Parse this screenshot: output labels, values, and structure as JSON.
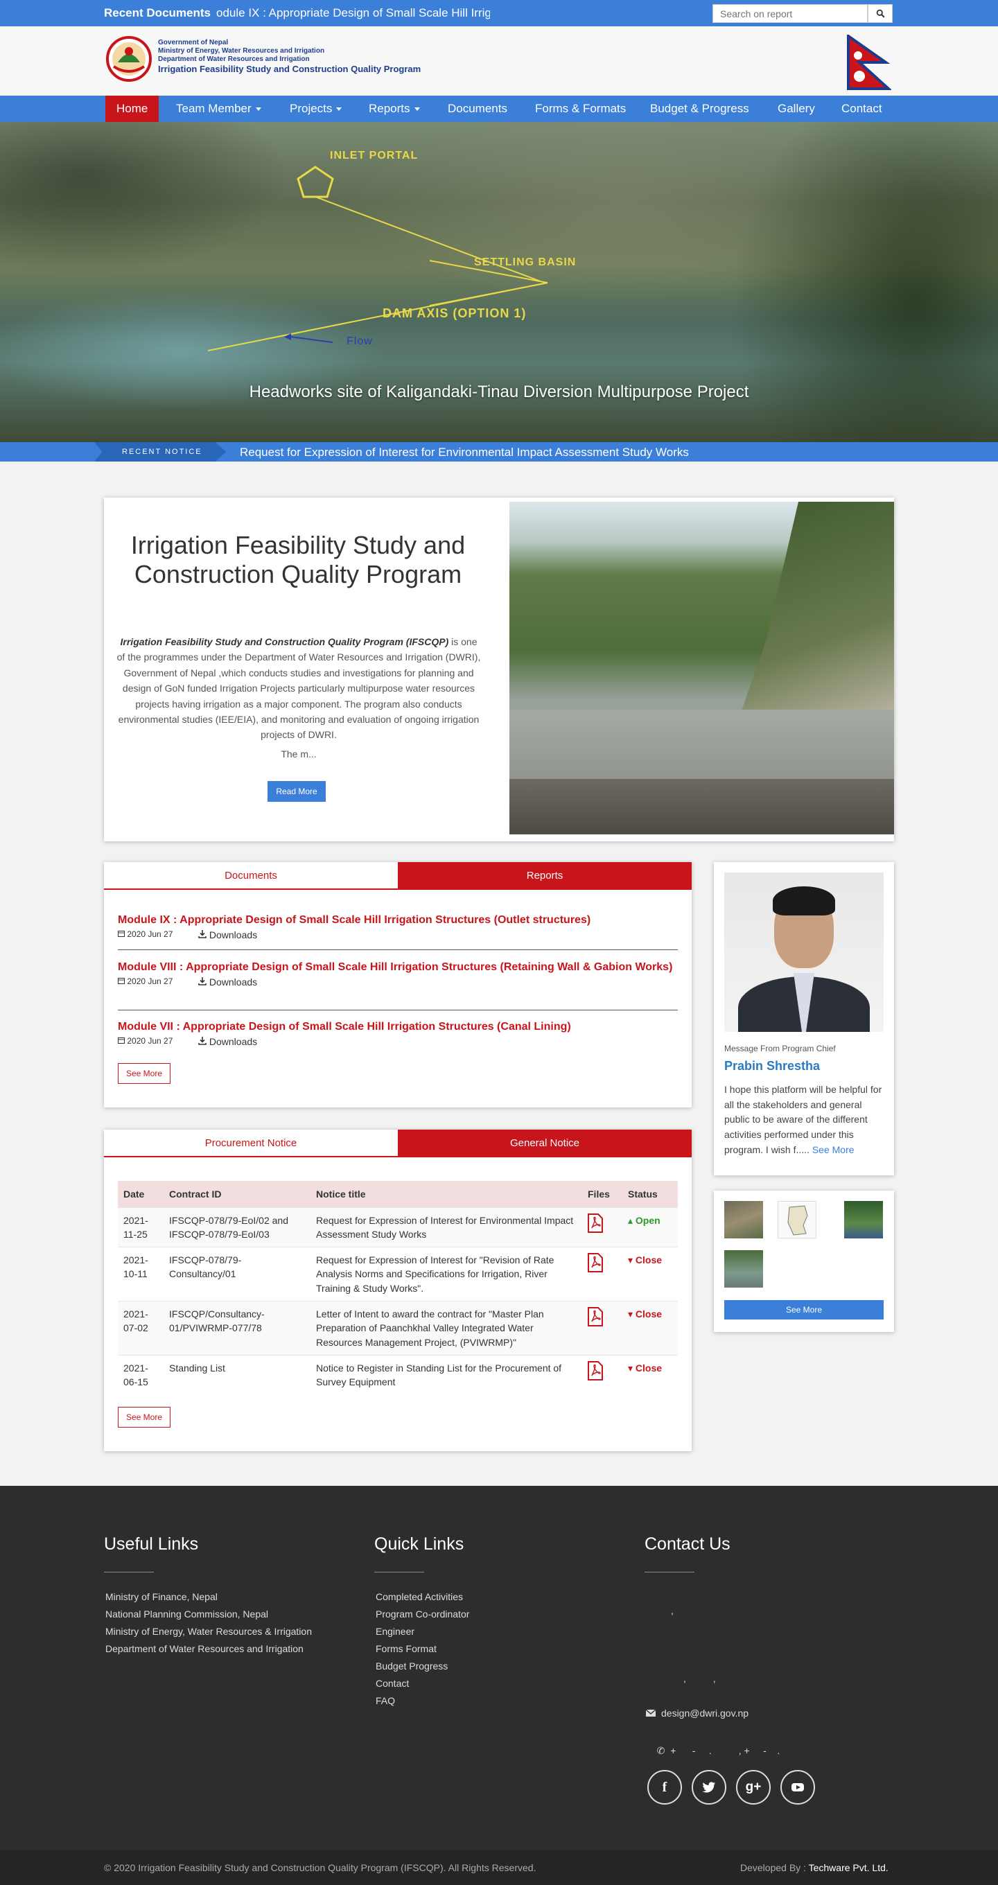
{
  "topbar": {
    "recent_documents_label": "Recent Documents",
    "recent_documents_marquee": "odule IX : Appropriate Design of Small Scale Hill Irrigatio",
    "search_placeholder": "Search on report"
  },
  "header": {
    "logo_line1": "Government of Nepal",
    "logo_line2": "Ministry of Energy, Water Resources and Irrigation",
    "logo_line3": "Department of Water Resources and Irrigation",
    "logo_line4": "Irrigation Feasibility Study and Construction Quality Program"
  },
  "nav": {
    "home": "Home",
    "team_member": "Team Member",
    "projects": "Projects",
    "reports": "Reports",
    "documents": "Documents",
    "forms_formats": "Forms & Formats",
    "budget_progress": "Budget & Progress",
    "gallery": "Gallery",
    "contact": "Contact"
  },
  "hero": {
    "caption": "Headworks site of Kaligandaki-Tinau Diversion Multipurpose Project",
    "label_inlet": "INLET PORTAL",
    "label_settling": "SETTLING BASIN",
    "label_dam": "DAM AXIS (OPTION 1)",
    "label_flow": "Flow"
  },
  "recent_notice": {
    "tag": "RECENT NOTICE",
    "text": "Request for Expression of Interest for Environmental Impact Assessment Study Works"
  },
  "intro": {
    "title": "Irrigation Feasibility Study and Construction Quality Program",
    "body_bold": "Irrigation Feasibility Study and Construction Quality Program (IFSCQP)",
    "body_rest": " is one of the programmes under the Department of Water Resources and Irrigation (DWRI), Government of Nepal ,which conducts studies and investigations for planning and design of GoN funded Irrigation Projects particularly multipurpose water resources projects having irrigation as a major component. The program also  conducts environmental studies (IEE/EIA), and monitoring and evaluation of ongoing irrigation projects of DWRI.",
    "more_text": "The m...",
    "read_more": "Read More"
  },
  "docs_tabs": {
    "documents": "Documents",
    "reports": "Reports",
    "items": [
      {
        "title": "Module IX : Appropriate Design of Small Scale Hill Irrigation Structures (Outlet structures)",
        "date": "2020 Jun 27",
        "downloads": "Downloads"
      },
      {
        "title": "Module VIII : Appropriate Design of Small Scale Hill Irrigation Structures (Retaining Wall & Gabion Works)",
        "date": "2020 Jun 27",
        "downloads": "Downloads"
      },
      {
        "title": "Module VII : Appropriate Design of Small Scale Hill Irrigation Structures (Canal Lining)",
        "date": "2020 Jun 27",
        "downloads": "Downloads"
      }
    ],
    "see_more": "See More"
  },
  "notice_tabs": {
    "procurement": "Procurement Notice",
    "general": "General Notice",
    "columns": [
      "Date",
      "Contract ID",
      "Notice title",
      "Files",
      "Status"
    ],
    "rows": [
      {
        "date": "2021-11-25",
        "contract_id": "IFSCQP-078/79-EoI/02 and IFSCQP-078/79-EoI/03",
        "title": "Request for Expression of Interest for Environmental Impact Assessment Study Works",
        "status": "Open"
      },
      {
        "date": "2021-10-11",
        "contract_id": "IFSCQP-078/79-Consultancy/01",
        "title": "Request for Expression of Interest for \"Revision of Rate Analysis Norms and Specifications for Irrigation, River Training & Study Works\".",
        "status": "Close"
      },
      {
        "date": "2021-07-02",
        "contract_id": "IFSCQP/Consultancy-01/PVIWRMP-077/78",
        "title": "Letter of Intent to award the contract for \"Master Plan Preparation of Paanchkhal Valley Integrated Water Resources Management Project, (PVIWRMP)\"",
        "status": "Close"
      },
      {
        "date": "2021-06-15",
        "contract_id": "Standing List",
        "title": "Notice to Register in Standing List for the Procurement of Survey Equipment",
        "status": "Close"
      }
    ],
    "see_more": "See More"
  },
  "chief": {
    "label": "Message From Program Chief",
    "name": "Prabin Shrestha",
    "message": "I hope this platform will be helpful for all the stakeholders and general public to be aware of the different activities performed under this program. I wish f.....",
    "see_more": "See More"
  },
  "gallery": {
    "see_more": "See More"
  },
  "footer": {
    "useful_links_title": "Useful Links",
    "useful_links": [
      "Ministry of Finance, Nepal",
      "National Planning Commission, Nepal",
      "Ministry of Energy, Water Resources & Irrigation",
      "Department of Water Resources and Irrigation"
    ],
    "quick_links_title": "Quick Links",
    "quick_links": [
      "Completed Activities",
      "Program Co-ordinator",
      "Engineer",
      "Forms Format",
      "Budget Progress",
      "Contact",
      "FAQ"
    ],
    "contact_title": "Contact Us",
    "contact_line1": ",",
    "contact_line2": ",          ,",
    "email": "design@dwri.gov.np",
    "phone": "+      -     .          , +     -    .",
    "copyright": "© 2020 Irrigation Feasibility Study and Construction Quality Program (IFSCQP). All Rights Reserved.",
    "developed_by_label": "Developed By :",
    "developed_by": "Techware Pvt. Ltd."
  },
  "colors": {
    "primary_blue": "#3b7fd9",
    "accent_red": "#c8151b",
    "footer_dark": "#2d2d2d"
  }
}
